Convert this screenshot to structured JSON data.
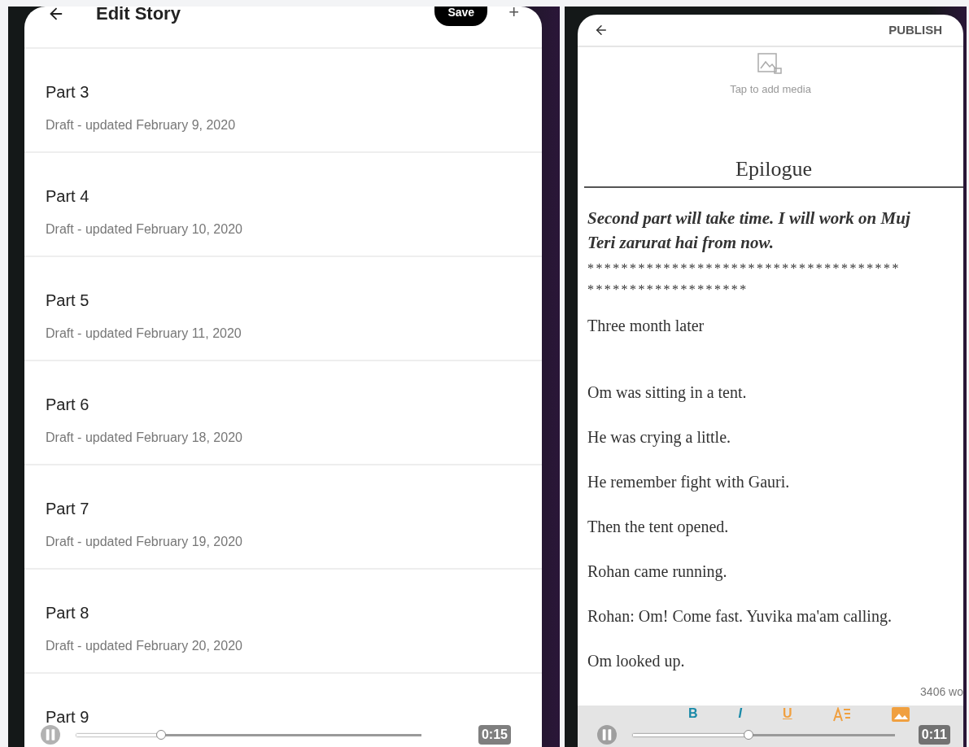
{
  "left_video": {
    "screen": {
      "title": "Edit Story",
      "save_button": "Save",
      "add_button": "+",
      "parts": [
        {
          "title": "Part 3",
          "status": "Draft - updated February 9, 2020"
        },
        {
          "title": "Part 4",
          "status": "Draft - updated February 10, 2020"
        },
        {
          "title": "Part 5",
          "status": "Draft - updated February 11, 2020"
        },
        {
          "title": "Part 6",
          "status": "Draft - updated February 18, 2020"
        },
        {
          "title": "Part 7",
          "status": "Draft - updated February 19, 2020"
        },
        {
          "title": "Part 8",
          "status": "Draft - updated February 20, 2020"
        },
        {
          "title": "Part 9"
        }
      ]
    },
    "player": {
      "playing": true,
      "level": 0.245,
      "time": "0:15"
    }
  },
  "right_video": {
    "screen": {
      "publish_button": "PUBLISH",
      "media_hint": "Tap to add media",
      "chapter_title": "Epilogue",
      "note_lines": [
        "Second part will take time. I will work on Muj",
        "Teri zarurat hai from now."
      ],
      "star_lines": [
        "*************************************",
        "*******************"
      ],
      "paragraphs": [
        "Three  month later",
        "Om was sitting in a tent.",
        "He was crying a little.",
        "He remember fight with Gauri.",
        "Then the tent opened.",
        "Rohan came running.",
        "Rohan: Om! Come fast. Yuvika ma'am calling.",
        "Om looked up."
      ],
      "word_count": "3406 wo",
      "toolbar": [
        "B",
        "I",
        "U"
      ]
    },
    "player": {
      "playing": true,
      "level": 0.44,
      "time": "0:11"
    }
  }
}
